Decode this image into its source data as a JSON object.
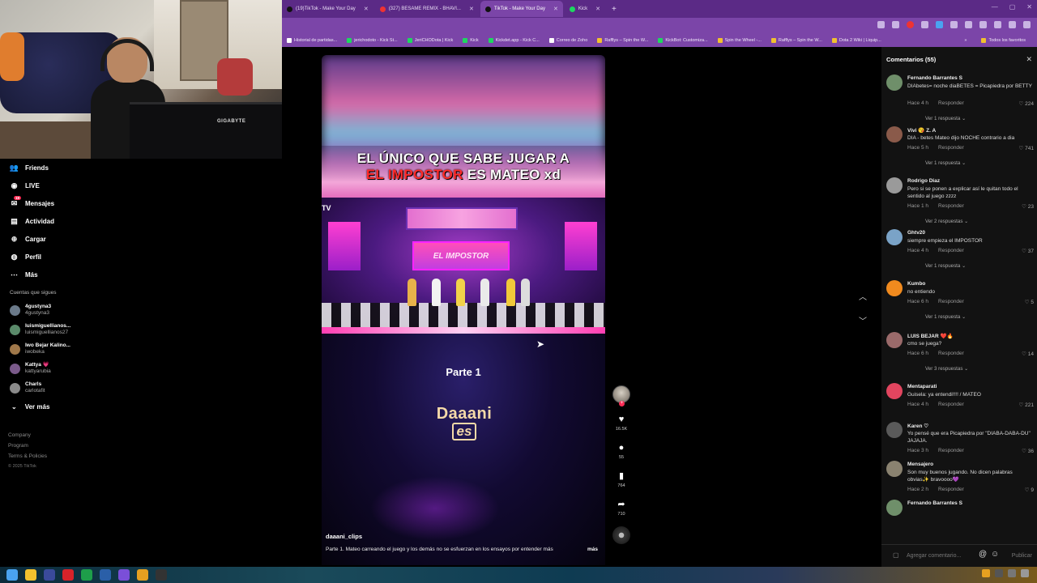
{
  "browser": {
    "tabs": [
      {
        "label": "(19)TikTok - Make Your Day",
        "active": false
      },
      {
        "label": "(327) BESAME REMIX - BHAVI...",
        "active": false
      },
      {
        "label": "TikTok - Make Your Day",
        "active": true
      },
      {
        "label": "Kick",
        "active": false
      }
    ],
    "bookmarks": [
      "Historial de partidas...",
      "jerichodoto - Kick St...",
      "JeriCHODota | Kick",
      "Kick",
      "Kickdet.app - Kick C...",
      "Correo de Zoho",
      "Rafflys – Spin the W...",
      "KickBot: Customiza...",
      "Spin the Wheel -...",
      "Rafflys – Spin the W...",
      "Dota 2 Wiki | Liquip..."
    ],
    "bookmarks_all": "Todos los favoritos"
  },
  "webcam": {
    "monitor_brand": "GIGABYTE"
  },
  "nav": {
    "items": [
      {
        "label": "Friends",
        "icon": "friends-icon"
      },
      {
        "label": "LIVE",
        "icon": "live-icon"
      },
      {
        "label": "Mensajes",
        "icon": "messages-icon",
        "badge": "19"
      },
      {
        "label": "Actividad",
        "icon": "activity-icon"
      },
      {
        "label": "Cargar",
        "icon": "upload-icon"
      },
      {
        "label": "Perfil",
        "icon": "profile-icon"
      },
      {
        "label": "Más",
        "icon": "more-icon"
      }
    ],
    "following_title": "Cuentas que sigues",
    "following": [
      {
        "name": "4gustyna3",
        "handle": "4gustyna3"
      },
      {
        "name": "luismiguellianos...",
        "handle": "luismiguellianos27"
      },
      {
        "name": "Iwo Bejar Kalino...",
        "handle": "iwobeka"
      },
      {
        "name": "Kattya 💗",
        "handle": "kattyarubia"
      },
      {
        "name": "Charls",
        "handle": "carlotafit"
      }
    ],
    "see_more": "Ver más",
    "footer": [
      "Company",
      "Program",
      "Terms & Policies"
    ],
    "copyright": "© 2025 TikTok"
  },
  "video": {
    "title_line1": "EL ÚNICO QUE SABE JUGAR A",
    "title_red": "EL IMPOSTOR",
    "title_rest": " ES MATEO xd",
    "stage_logo": "EL IMPOSTOR",
    "tv_mark": "TV",
    "part": "Parte 1",
    "watermark_line1": "Daaani",
    "watermark_line2": "es",
    "username": "daaani_clips",
    "description": "Parte 1. Mateo carreando el juego y los demás no se esfuerzan en los ensayos por entender más",
    "more": "más"
  },
  "actions": {
    "likes": "16.5K",
    "comments": "55",
    "saves": "764",
    "shares": "710"
  },
  "comments_panel": {
    "title": "Comentarios (55)",
    "reply_label": "Responder",
    "input_placeholder": "Agregar comentario...",
    "publish_label": "Publicar",
    "items": [
      {
        "user": "Fernando Barrantes S",
        "text": "DIAbetes= noche diaBETES = Picapiedra por BETTY",
        "time": "Hace 4 h",
        "likes": "224",
        "replies": "Ver 1 respuesta",
        "color": "#6f8f6a"
      },
      {
        "user": "Vivi 😘 Z. A",
        "text": "DIA - betes Mateo dijo NOCHE contrario a dia",
        "time": "Hace 5 h",
        "likes": "741",
        "replies": "Ver 1 respuesta",
        "color": "#8a5a4a"
      },
      {
        "user": "Rodrigo Diaz",
        "text": "Pero si se ponen a explicar así le quitan todo el sentido al juego zzzz",
        "time": "Hace 1 h",
        "likes": "23",
        "replies": "Ver 2 respuestas",
        "color": "#9a9a9a"
      },
      {
        "user": "Ghtv20",
        "text": "siempre empieza el IMPOSTOR",
        "time": "Hace 4 h",
        "likes": "37",
        "replies": "Ver 1 respuesta",
        "color": "#7aa3c7"
      },
      {
        "user": "Kumbo",
        "text": "no entiendo",
        "time": "Hace 6 h",
        "likes": "5",
        "replies": "Ver 1 respuesta",
        "color": "#f08a1e"
      },
      {
        "user": "LUIS BEJAR ❤️🔥",
        "text": "cmo se juega?",
        "time": "Hace 6 h",
        "likes": "14",
        "replies": "Ver 3 respuestas",
        "color": "#9a6a6a"
      },
      {
        "user": "Mentaparati",
        "text": "Guisela: ya entendi!!!! / MATEO",
        "time": "Hace 4 h",
        "likes": "221",
        "replies": "",
        "color": "#e2455f"
      },
      {
        "user": "Karen ♡",
        "text": "Yo pensé que era Picapiedra por \"DIABA-DABA-DU\" JAJAJA.",
        "time": "Hace 3 h",
        "likes": "36",
        "replies": "",
        "color": "#5a5a5a"
      },
      {
        "user": "Mensajero",
        "text": "Son muy buenos jugando. No dicen palabras obvias✨ bravoooo💜",
        "time": "Hace 2 h",
        "likes": "9",
        "replies": "",
        "color": "#8a8270"
      },
      {
        "user": "Fernando Barrantes S",
        "text": "",
        "time": "",
        "likes": "",
        "replies": "",
        "color": "#6f8f6a"
      }
    ]
  }
}
